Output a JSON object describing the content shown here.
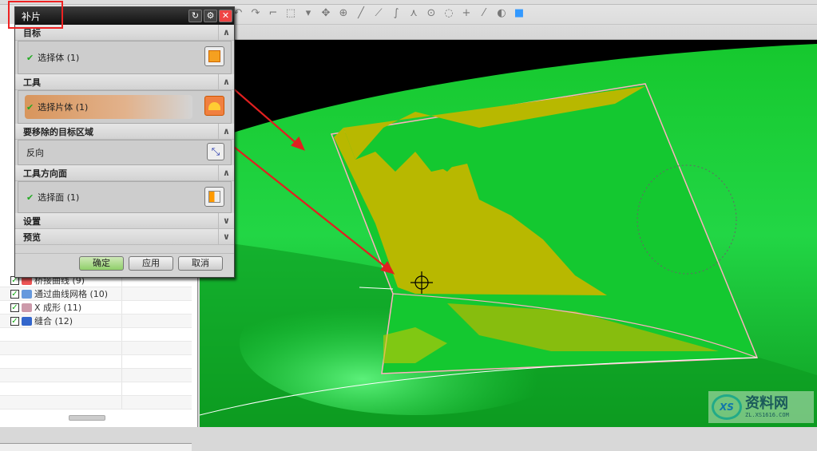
{
  "dialog": {
    "title": "补片",
    "sections": [
      {
        "header": "目标",
        "item": "选择体 (1)",
        "expanded": true
      },
      {
        "header": "工具",
        "item": "选择片体 (1)",
        "expanded": true
      },
      {
        "header": "要移除的目标区域",
        "item": "反向",
        "expanded": true
      },
      {
        "header": "工具方向面",
        "item": "选择面 (1)",
        "expanded": true
      },
      {
        "header": "设置",
        "expanded": false
      },
      {
        "header": "预览",
        "expanded": false
      }
    ],
    "buttons": {
      "ok": "确定",
      "apply": "应用",
      "cancel": "取消"
    }
  },
  "navigator": {
    "items": [
      {
        "label": "桥接曲线 (9)",
        "checked": true
      },
      {
        "label": "通过曲线网格 (10)",
        "checked": true
      },
      {
        "label": "X 成形 (11)",
        "checked": true
      },
      {
        "label": "缝合 (12)",
        "checked": true
      }
    ]
  },
  "watermark": {
    "text": "资料网",
    "url": "ZL.XS1616.COM",
    "logo": "XS"
  },
  "colors": {
    "surface": "#1fd23c",
    "patch": "#b8b800",
    "annotation": "#e02020"
  }
}
